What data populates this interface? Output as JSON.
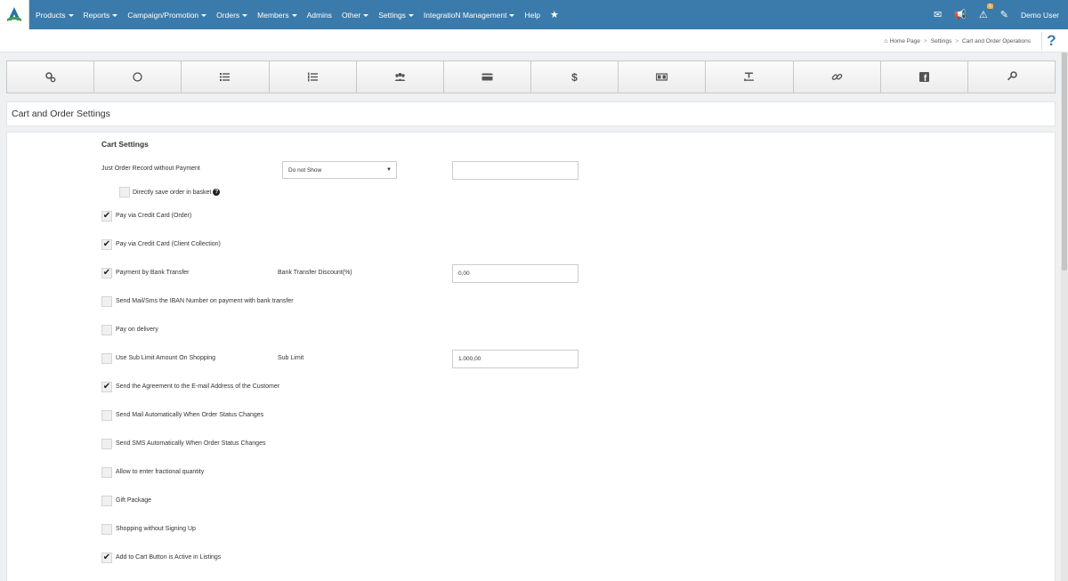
{
  "topbar": {
    "menu": [
      {
        "label": "Products",
        "caret": true
      },
      {
        "label": "Reports",
        "caret": true
      },
      {
        "label": "Campaign/Promotion",
        "caret": true
      },
      {
        "label": "Orders",
        "caret": true
      },
      {
        "label": "Members",
        "caret": true
      },
      {
        "label": "Admins",
        "caret": false
      },
      {
        "label": "Other",
        "caret": true
      },
      {
        "label": "Settings",
        "caret": true
      },
      {
        "label": "IntegratioN Management",
        "caret": true
      },
      {
        "label": "Help",
        "caret": false
      }
    ],
    "user_name": "Demo User",
    "notification_badge": "1"
  },
  "breadcrumb": {
    "home": "Home Page",
    "settings": "Settings",
    "current": "Cart and Order Operations",
    "separator": ">"
  },
  "help_label": "?",
  "tabs": [
    "gears-icon",
    "circle-icon",
    "list-icon",
    "ordered-list-icon",
    "users-icon",
    "credit-card-icon",
    "dollar-icon",
    "money-icon",
    "text-format-icon",
    "link-icon",
    "facebook-icon",
    "key-icon"
  ],
  "section_title": "Cart and Order Settings",
  "cart_settings": {
    "title": "Cart Settings",
    "just_order_label": "Just Order Record without Payment",
    "just_order_select": "Do not Show",
    "just_order_input": "",
    "directly_save_label": "Directly save order in basket",
    "items": [
      {
        "label": "Pay via Credit Card (Order)",
        "checked": true
      },
      {
        "label": "Pay via Credit Card (Client Collection)",
        "checked": true
      },
      {
        "label": "Payment by Bank Transfer",
        "checked": true,
        "field_label": "Bank Transfer Discount(%)",
        "field_value": "0,00"
      },
      {
        "label": "Send Mail/Sms the IBAN Number on payment with bank transfer",
        "checked": false
      },
      {
        "label": "Pay on delivery",
        "checked": false
      },
      {
        "label": "Use Sub Limit Amount On Shopping",
        "checked": false,
        "field_label": "Sub Limit",
        "field_value": "1.000,00"
      },
      {
        "label": "Send the Agreement to the E-mail Address of the Customer",
        "checked": true
      },
      {
        "label": "Send Mail Automatically When Order Status Changes",
        "checked": false
      },
      {
        "label": "Send SMS Automatically When Order Status Changes",
        "checked": false
      },
      {
        "label": "Allow to enter fractional quantity",
        "checked": false
      },
      {
        "label": "Gift Package",
        "checked": false
      },
      {
        "label": "Shopping without Signing Up",
        "checked": false
      },
      {
        "label": "Add to Cart Button is Active in Listings",
        "checked": true
      }
    ]
  },
  "colors": {
    "topbar": "#3b7bab",
    "background": "#eef0f2"
  }
}
